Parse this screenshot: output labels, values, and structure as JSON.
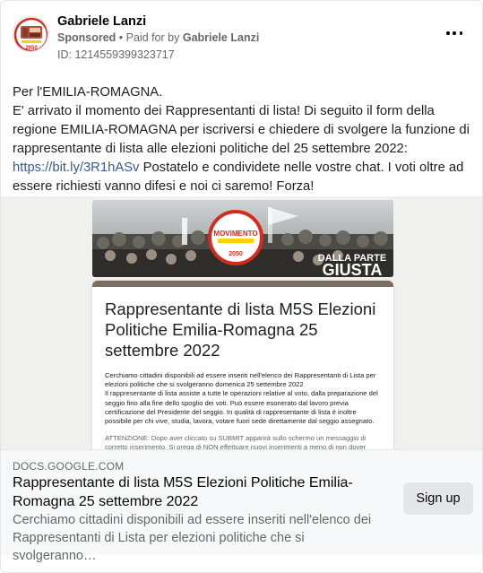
{
  "post": {
    "page_name": "Gabriele Lanzi",
    "sponsored_label": "Sponsored",
    "separator": " • ",
    "paid_for_prefix": "Paid for by ",
    "payer": "Gabriele Lanzi",
    "ad_id": "ID: 1214559399323717",
    "avatar_badge": "2050",
    "body_line1": "Per l'EMILIA-ROMAGNA.",
    "body_line2": "E' arrivato il momento dei Rappresentanti di lista! Di seguito il form della regione EMILIA-ROMAGNA per iscriversi e chiedere di svolgere la funzione di rappresentante di lista alle elezioni politiche del 25 settembre 2022:",
    "link_text": "https://bit.ly/3R1hASv",
    "body_after_link": " Postatelo e condividete nelle vostre chat. I voti oltre ad essere richiesti vanno difesi e noi ci saremo! Forza!"
  },
  "media": {
    "logo_word": "MOVIMENTO",
    "logo_year": "2050",
    "banner_tag_top": "DALLA PARTE",
    "banner_tag_bottom": "GIUSTA",
    "form_title": "Rappresentante di lista M5S Elezioni Politiche Emilia-Romagna 25 settembre 2022",
    "form_para1": "Cerchiamo cittadini disponibili ad essere inseriti nell'elenco dei Rappresentanti di Lista per elezioni politiche che si svolgeranno domenica 25 settembre 2022",
    "form_para2": "Il rappresentante di lista assiste a tutte le operazioni relative al voto, dalla preparazione del seggio fino alla fine dello spoglio dei voti. Può essere esonerato dal lavoro previa certificazione del Presidente del seggio. In qualità di rappresentante di lista è inoltre possibile per chi vive, studia, lavora, votare fuori sede direttamente dal seggio assegnato.",
    "form_para3": "ATTENZIONE: Dopo aver cliccato su SUBMIT apparirà sullo schermo un messaggio di corretto inserimento. Si prega di NON effettuare nuovi inserimenti a meno di non dover modificare qualcosa (in tal caso l'inserimento più recente sarà quello considerato). Grazie"
  },
  "link_preview": {
    "domain": "DOCS.GOOGLE.COM",
    "title": "Rappresentante di lista M5S Elezioni Politiche Emilia-Romagna 25 settembre 2022",
    "description": "Cerchiamo cittadini disponibili ad essere inseriti nell'elenco dei Rappresentanti di Lista per elezioni politiche che si svolgeranno…",
    "cta_label": "Sign up"
  },
  "colors": {
    "link": "#385898",
    "m5s_red": "#d52b1e",
    "m5s_yellow": "#ffd200",
    "form_header": "#7a6e62"
  },
  "icons": {
    "more": "more-options-icon"
  }
}
